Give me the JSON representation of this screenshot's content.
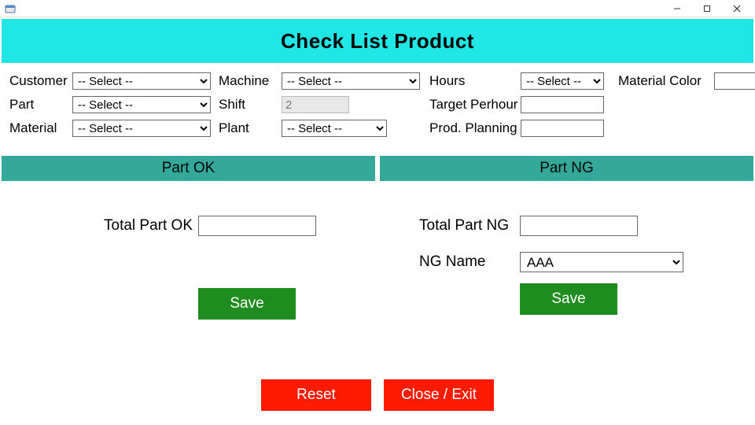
{
  "window": {
    "title": ""
  },
  "header": {
    "title": "Check List Product"
  },
  "form": {
    "customer": {
      "label": "Customer",
      "value": "-- Select --"
    },
    "part": {
      "label": "Part",
      "value": "-- Select --"
    },
    "material": {
      "label": "Material",
      "value": "-- Select --"
    },
    "machine": {
      "label": "Machine",
      "value": "-- Select --"
    },
    "shift": {
      "label": "Shift",
      "value": "2"
    },
    "plant": {
      "label": "Plant",
      "value": "-- Select --"
    },
    "hours": {
      "label": "Hours",
      "value": "-- Select --"
    },
    "target": {
      "label": "Target Perhour",
      "value": ""
    },
    "prodplan": {
      "label": "Prod. Planning",
      "value": ""
    },
    "matcolor": {
      "label": "Material Color",
      "value": ""
    }
  },
  "sections": {
    "ok": {
      "title": "Part OK"
    },
    "ng": {
      "title": "Part NG"
    }
  },
  "ok": {
    "total_label": "Total Part OK",
    "total_value": "",
    "save_label": "Save"
  },
  "ng": {
    "total_label": "Total Part NG",
    "total_value": "",
    "name_label": "NG Name",
    "name_value": "AAA",
    "save_label": "Save"
  },
  "actions": {
    "reset": "Reset",
    "close": "Close / Exit"
  }
}
